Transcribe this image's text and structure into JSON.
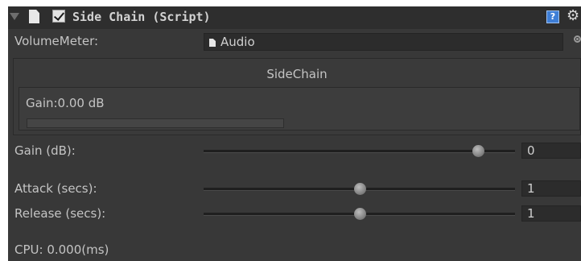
{
  "header": {
    "title": "Side Chain (Script)",
    "enabled": true,
    "icons": [
      "foldout-arrow-icon",
      "script-file-icon",
      "help-icon",
      "gear-icon"
    ]
  },
  "fields": {
    "volume_meter_label": "VolumeMeter:",
    "volume_meter_value": "Audio"
  },
  "sidechain": {
    "title": "SideChain",
    "gain_readout": "Gain:0.00 dB",
    "meter_level": 0
  },
  "sliders": [
    {
      "label": "Gain (dB):",
      "value": "0",
      "fraction": 0.88
    },
    {
      "label": "Attack (secs):",
      "value": "1",
      "fraction": 0.5
    },
    {
      "label": "Release (secs):",
      "value": "1",
      "fraction": 0.5
    }
  ],
  "cpu_text": "CPU: 0.000(ms)",
  "colors": {
    "panel": "#383838",
    "header": "#2e2e2e",
    "text": "#c4c4c4",
    "help_icon": "#3e7ed6"
  }
}
